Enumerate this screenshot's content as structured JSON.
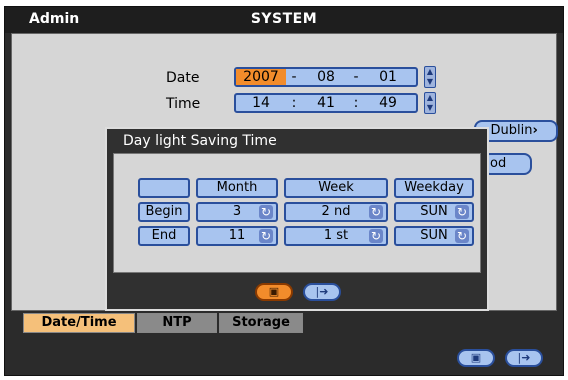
{
  "window": {
    "user": "Admin",
    "title": "SYSTEM"
  },
  "date": {
    "label": "Date",
    "year": "2007",
    "month": "08",
    "day": "01",
    "sep": "-"
  },
  "time": {
    "label": "Time",
    "hour": "14",
    "minute": "41",
    "second": "49",
    "sep": ":"
  },
  "timezone_partial": ": Dublin",
  "method_partial": "od",
  "dst_dialog": {
    "title": "Day light Saving Time",
    "headers": [
      "Month",
      "Week",
      "Weekday"
    ],
    "rows": [
      {
        "label": "Begin",
        "month": "3",
        "week": "2 nd",
        "weekday": "SUN"
      },
      {
        "label": "End",
        "month": "11",
        "week": "1 st",
        "weekday": "SUN"
      }
    ],
    "save_icon": "save-icon",
    "exit_icon": "exit-icon"
  },
  "tabs": [
    {
      "label": "Date/Time",
      "active": true
    },
    {
      "label": "NTP",
      "active": false
    },
    {
      "label": "Storage",
      "active": false
    }
  ],
  "footer": {
    "save_icon": "save-icon",
    "exit_icon": "exit-icon"
  },
  "colors": {
    "highlight": "#f28c2b",
    "field": "#a8c4ef",
    "field_border": "#2a4f9c",
    "tab_active": "#f5c07a"
  }
}
